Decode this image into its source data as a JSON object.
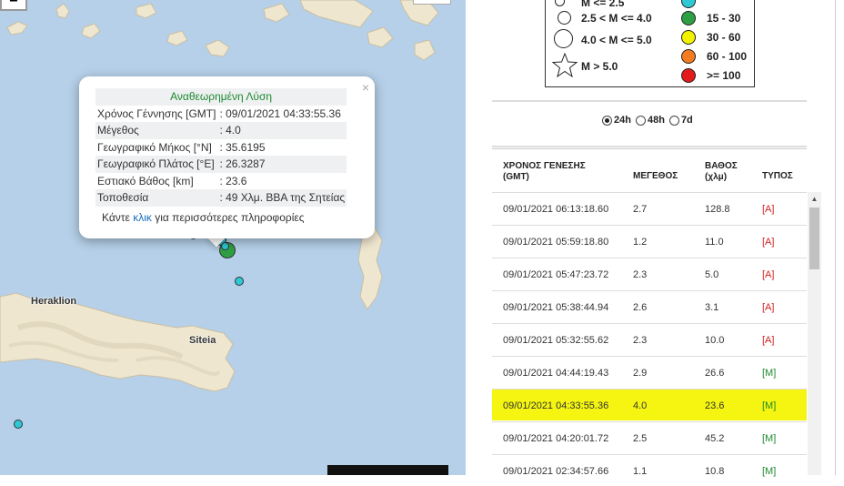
{
  "map": {
    "zoom_in": "−",
    "cities": [
      "Heraklion",
      "Siteia"
    ],
    "colors": {
      "sea": "#b5d0e8",
      "land": "#efe6cf",
      "quake_cyan": "#2ec9d4",
      "quake_green": "#2e9f45"
    }
  },
  "popup": {
    "title": "Αναθεωρημένη Λύση",
    "close": "×",
    "rows": [
      {
        "label": "Χρόνος Γέννησης [GMT]",
        "value": ": 09/01/2021 04:33:55.36"
      },
      {
        "label": "Μέγεθος",
        "value": ": 4.0"
      },
      {
        "label": "Γεωγραφικό Μήκος [°N]",
        "value": ": 35.6195"
      },
      {
        "label": "Γεωγραφικό Πλάτος [°E]",
        "value": ": 26.3287"
      },
      {
        "label": "Εστιακό Βάθος [km]",
        "value": ": 23.6"
      },
      {
        "label": "Τοποθεσία",
        "value": ": 49 Χλμ. ΒΒΑ της Σητείας"
      }
    ],
    "more_prefix": "Κάντε ",
    "more_link": "κλικ",
    "more_suffix": " για περισσότερες πληροφορίες"
  },
  "legend": {
    "magnitude": [
      "M <= 2.5",
      "2.5 < M <= 4.0",
      "4.0 < M <= 5.0",
      "M > 5.0"
    ],
    "depth": [
      {
        "label": "15 - 30",
        "color": "#2e9f45"
      },
      {
        "label": "30 - 60",
        "color": "#f2f200"
      },
      {
        "label": "60 - 100",
        "color": "#f47c20"
      },
      {
        "label": ">= 100",
        "color": "#e31b1b"
      }
    ],
    "depth_top_color": "#2ec9d4"
  },
  "period": {
    "options": [
      "24h",
      "48h",
      "7d"
    ],
    "selected": "24h"
  },
  "table": {
    "headers": {
      "time_1": "ΧΡΟΝΟΣ ΓΕΝΕΣΗΣ",
      "time_2": "(GMT)",
      "mag": "ΜΕΓΕΘΟΣ",
      "depth_1": "ΒΑΘΟΣ",
      "depth_2": "(χλμ)",
      "type": "ΤΥΠΟΣ"
    },
    "rows": [
      {
        "time": "09/01/2021 06:13:18.60",
        "mag": "2.7",
        "depth": "128.8",
        "type": "[A]"
      },
      {
        "time": "09/01/2021 05:59:18.80",
        "mag": "1.2",
        "depth": "11.0",
        "type": "[A]"
      },
      {
        "time": "09/01/2021 05:47:23.72",
        "mag": "2.3",
        "depth": "5.0",
        "type": "[A]"
      },
      {
        "time": "09/01/2021 05:38:44.94",
        "mag": "2.6",
        "depth": "3.1",
        "type": "[A]"
      },
      {
        "time": "09/01/2021 05:32:55.62",
        "mag": "2.3",
        "depth": "10.0",
        "type": "[A]"
      },
      {
        "time": "09/01/2021 04:44:19.43",
        "mag": "2.9",
        "depth": "26.6",
        "type": "[M]"
      },
      {
        "time": "09/01/2021 04:33:55.36",
        "mag": "4.0",
        "depth": "23.6",
        "type": "[M]",
        "highlight": true
      },
      {
        "time": "09/01/2021 04:20:01.72",
        "mag": "2.5",
        "depth": "45.2",
        "type": "[M]"
      },
      {
        "time": "09/01/2021 02:34:57.66",
        "mag": "1.1",
        "depth": "10.8",
        "type": "[M]"
      }
    ]
  }
}
